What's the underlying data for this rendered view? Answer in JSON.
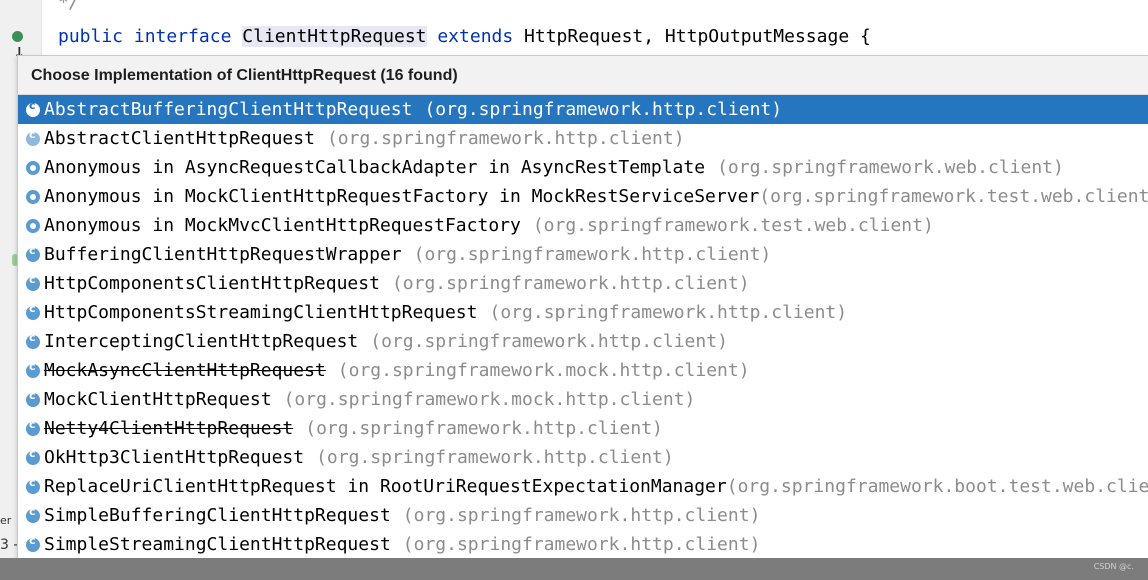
{
  "editor": {
    "comment": "*/",
    "code": {
      "kw1": "public",
      "kw2": "interface",
      "name": "ClientHttpRequest",
      "kw3": "extends",
      "rest": "HttpRequest, HttpOutputMessage {"
    },
    "left_fragment_1": "er",
    "left_fragment_2": "3 -"
  },
  "popup": {
    "title": "Choose Implementation of ClientHttpRequest (16 found)",
    "items": [
      {
        "name": "AbstractBufferingClientHttpRequest",
        "package": "(org.springframework.http.client)",
        "icon": "abstract-class-icon",
        "selected": true,
        "deprecated": false
      },
      {
        "name": "AbstractClientHttpRequest",
        "package": "(org.springframework.http.client)",
        "icon": "abstract-class-icon",
        "selected": false,
        "deprecated": false
      },
      {
        "name": "Anonymous in AsyncRequestCallbackAdapter in AsyncRestTemplate",
        "package": "(org.springframework.web.client)",
        "icon": "anonymous-class-icon",
        "selected": false,
        "deprecated": false
      },
      {
        "name": "Anonymous in MockClientHttpRequestFactory in MockRestServiceServer",
        "package": "(org.springframework.test.web.client)",
        "icon": "anonymous-class-icon",
        "selected": false,
        "deprecated": false
      },
      {
        "name": "Anonymous in MockMvcClientHttpRequestFactory",
        "package": "(org.springframework.test.web.client)",
        "icon": "anonymous-class-icon",
        "selected": false,
        "deprecated": false
      },
      {
        "name": "BufferingClientHttpRequestWrapper",
        "package": "(org.springframework.http.client)",
        "icon": "class-icon",
        "selected": false,
        "deprecated": false
      },
      {
        "name": "HttpComponentsClientHttpRequest",
        "package": "(org.springframework.http.client)",
        "icon": "class-icon",
        "selected": false,
        "deprecated": false
      },
      {
        "name": "HttpComponentsStreamingClientHttpRequest",
        "package": "(org.springframework.http.client)",
        "icon": "class-icon",
        "selected": false,
        "deprecated": false
      },
      {
        "name": "InterceptingClientHttpRequest",
        "package": "(org.springframework.http.client)",
        "icon": "class-icon",
        "selected": false,
        "deprecated": false
      },
      {
        "name": "MockAsyncClientHttpRequest",
        "package": "(org.springframework.mock.http.client)",
        "icon": "class-icon",
        "selected": false,
        "deprecated": true
      },
      {
        "name": "MockClientHttpRequest",
        "package": "(org.springframework.mock.http.client)",
        "icon": "class-icon",
        "selected": false,
        "deprecated": false
      },
      {
        "name": "Netty4ClientHttpRequest",
        "package": "(org.springframework.http.client)",
        "icon": "class-icon",
        "selected": false,
        "deprecated": true
      },
      {
        "name": "OkHttp3ClientHttpRequest",
        "package": "(org.springframework.http.client)",
        "icon": "class-icon",
        "selected": false,
        "deprecated": false
      },
      {
        "name": "ReplaceUriClientHttpRequest in RootUriRequestExpectationManager",
        "package": "(org.springframework.boot.test.web.client)",
        "icon": "class-icon",
        "selected": false,
        "deprecated": false
      },
      {
        "name": "SimpleBufferingClientHttpRequest",
        "package": "(org.springframework.http.client)",
        "icon": "class-icon",
        "selected": false,
        "deprecated": false
      },
      {
        "name": "SimpleStreamingClientHttpRequest",
        "package": "(org.springframework.http.client)",
        "icon": "class-icon",
        "selected": false,
        "deprecated": false
      }
    ]
  },
  "colors": {
    "selection": "#2675bf",
    "package_text": "#8c8c8c",
    "keyword": "#0033b3"
  },
  "watermark": "CSDN @c."
}
